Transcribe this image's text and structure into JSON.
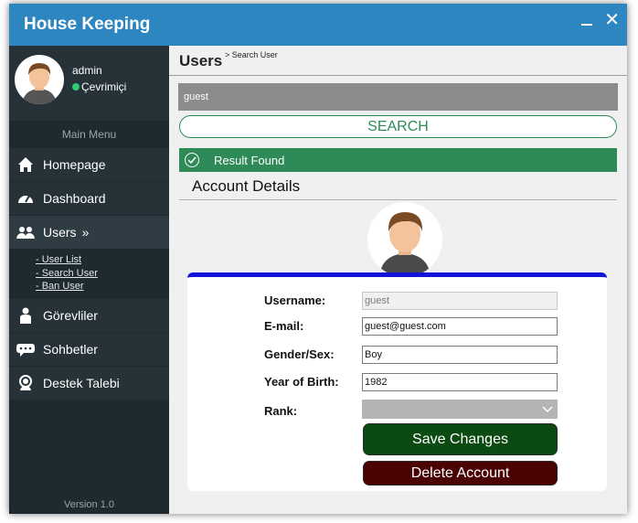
{
  "app": {
    "title": "House Keeping"
  },
  "profile": {
    "name": "admin",
    "status": "Çevrimiçi"
  },
  "menu": {
    "title": "Main Menu",
    "items": [
      {
        "label": "Homepage",
        "icon": "home-icon"
      },
      {
        "label": "Dashboard",
        "icon": "dashboard-icon"
      },
      {
        "label": "Users",
        "icon": "users-icon",
        "active": true,
        "chevron": "»"
      },
      {
        "label": "Görevliler",
        "icon": "person-icon"
      },
      {
        "label": "Sohbetler",
        "icon": "chat-icon"
      },
      {
        "label": "Destek Talebi",
        "icon": "support-icon"
      }
    ],
    "users_submenu": [
      "- User List",
      "- Search User",
      "- Ban User"
    ]
  },
  "version": "Version 1.0",
  "page": {
    "title": "Users",
    "breadcrumb": "> Search User"
  },
  "search": {
    "value": "guest",
    "button_label": "SEARCH"
  },
  "result": {
    "message": "Result Found"
  },
  "account": {
    "title": "Account Details",
    "fields": {
      "username": {
        "label": "Username:",
        "value": "guest"
      },
      "email": {
        "label": "E-mail:",
        "value": "guest@guest.com"
      },
      "gender": {
        "label": "Gender/Sex:",
        "value": "Boy"
      },
      "year": {
        "label": "Year of Birth:",
        "value": "1982"
      },
      "rank": {
        "label": "Rank:",
        "value": ""
      }
    },
    "save_label": "Save Changes",
    "delete_label": "Delete Account"
  },
  "colors": {
    "brand": "#2e86c1",
    "sidebar": "#263238",
    "success": "#2e8b57",
    "save": "#0b4a10",
    "delete": "#4a0202",
    "card_accent": "#1414d8"
  }
}
